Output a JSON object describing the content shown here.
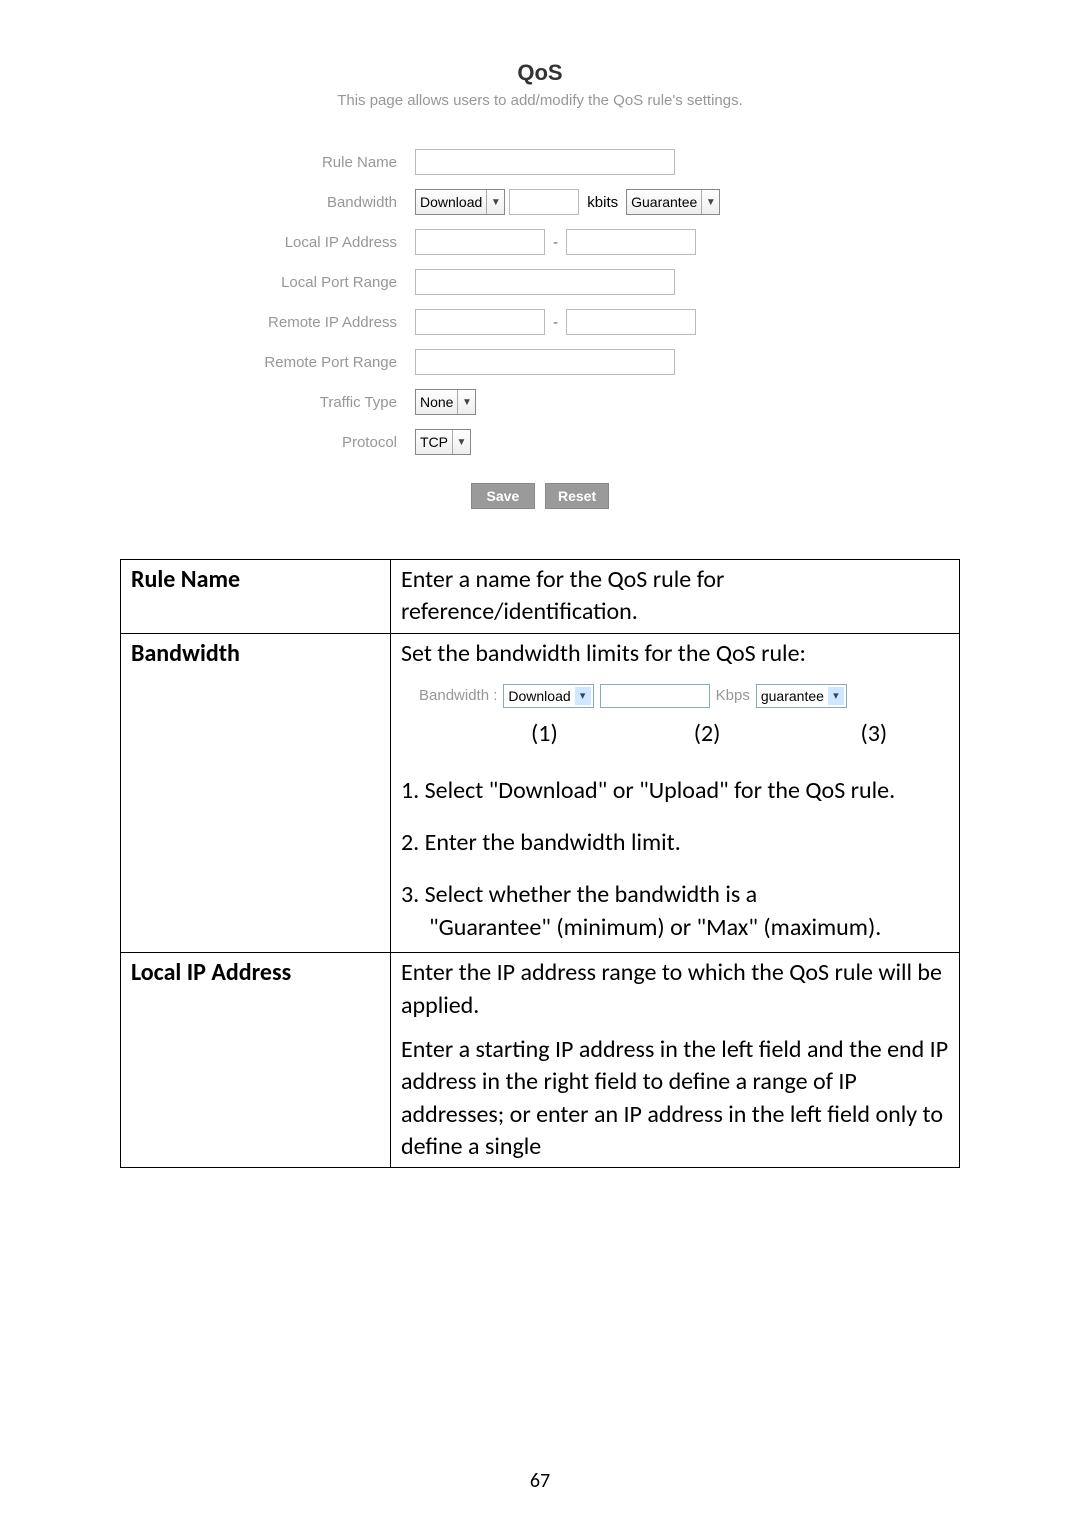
{
  "page_number": "67",
  "qos": {
    "title": "QoS",
    "subtitle": "This page allows users to add/modify the QoS rule's settings.",
    "labels": {
      "rule_name": "Rule Name",
      "bandwidth": "Bandwidth",
      "local_ip": "Local IP Address",
      "local_port": "Local Port Range",
      "remote_ip": "Remote IP Address",
      "remote_port": "Remote Port Range",
      "traffic_type": "Traffic Type",
      "protocol": "Protocol"
    },
    "values": {
      "bandwidth_dir": "Download",
      "bandwidth_unit": "kbits",
      "bandwidth_type": "Guarantee",
      "traffic_type": "None",
      "protocol": "TCP",
      "dash": "-"
    },
    "buttons": {
      "save": "Save",
      "reset": "Reset"
    }
  },
  "doc_table": {
    "rule_name": {
      "header": "Rule Name",
      "desc": "Enter a name for the QoS rule for reference/identification."
    },
    "bandwidth": {
      "header": "Bandwidth",
      "intro": "Set the bandwidth limits for the QoS rule:",
      "example": {
        "label": "Bandwidth :",
        "dir": "Download",
        "unit": "Kbps",
        "type": "guarantee"
      },
      "nums": {
        "n1": "(1)",
        "n2": "(2)",
        "n3": "(3)"
      },
      "step1": "1.  Select \"Download\" or \"Upload\" for the QoS rule.",
      "step2": "2.  Enter the bandwidth limit.",
      "step3a": "3.  Select whether the bandwidth is a",
      "step3b": "\"Guarantee\" (minimum) or \"Max\" (maximum)."
    },
    "local_ip": {
      "header": "Local IP Address",
      "para1": "Enter the IP address range to which the QoS rule will be applied.",
      "para2": "Enter a starting IP address in the left field and the end IP address in the right field to define a range of IP addresses; or enter an IP address in the left field only to define a single"
    }
  }
}
